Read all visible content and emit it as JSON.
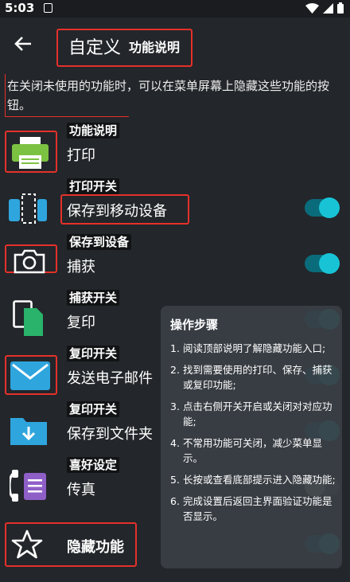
{
  "status_bar": {
    "time": "5:03"
  },
  "app_bar": {
    "title": "自定义",
    "subtitle": "功能说明"
  },
  "info_text": "在关闭未使用的功能时，可以在菜单屏幕上隐藏这些功能的按钮。",
  "items": [
    {
      "label": "打印",
      "tag": "功能说明",
      "icon": "printer-icon",
      "toggle": null
    },
    {
      "label": "保存到移动设备",
      "tag": "打印开关",
      "icon": "save-to-device-icon",
      "toggle": "on"
    },
    {
      "label": "捕获",
      "tag": "保存到设备",
      "icon": "camera-icon",
      "toggle": "on"
    },
    {
      "label": "复印",
      "tag": "捕获开关",
      "icon": "copy-icon",
      "toggle": "on"
    },
    {
      "label": "发送电子邮件",
      "tag": "复印开关",
      "icon": "mail-icon",
      "toggle": "on"
    },
    {
      "label": "保存到文件夹",
      "tag": "复印开关",
      "icon": "folder-icon",
      "toggle": "on"
    },
    {
      "label": "传真",
      "tag": "喜好设定",
      "icon": "fax-icon",
      "toggle": "off"
    },
    {
      "label": "隐藏功能",
      "tag": "",
      "icon": "star-icon",
      "toggle": "on"
    }
  ],
  "overlay": {
    "title": "操作步骤",
    "steps": [
      {
        "num": "1.",
        "text": "阅读顶部说明了解隐藏功能入口;"
      },
      {
        "num": "2.",
        "text": "找到需要使用的打印、保存、捕获或复印功能;"
      },
      {
        "num": "3.",
        "text": "点击右侧开关开启或关闭对对应功能;"
      },
      {
        "num": "4.",
        "text": "不常用功能可关闭，减少菜单显示。"
      },
      {
        "num": "5.",
        "text": "长按或查看底部提示进入隐藏功能;"
      },
      {
        "num": "6.",
        "text": "完成设置后返回主界面验证功能是否显示。"
      }
    ]
  },
  "colors": {
    "accent": "#18c3d6",
    "highlight": "#e4312b",
    "background": "#23262a"
  }
}
